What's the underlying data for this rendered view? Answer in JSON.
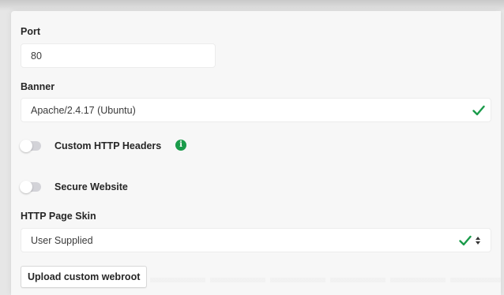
{
  "port": {
    "label": "Port",
    "value": "80"
  },
  "banner": {
    "label": "Banner",
    "value": "Apache/2.4.17 (Ubuntu)",
    "valid_icon": "check-icon"
  },
  "custom_headers": {
    "label": "Custom HTTP Headers",
    "enabled": false,
    "info_icon": "info-icon",
    "info_glyph": "i"
  },
  "secure_website": {
    "label": "Secure Website",
    "enabled": false
  },
  "page_skin": {
    "label": "HTTP Page Skin",
    "value": "User Supplied",
    "valid_icon": "check-icon",
    "select_icon": "select-arrows-icon"
  },
  "upload_button": {
    "label": "Upload custom webroot"
  },
  "colors": {
    "accent_green": "#1a9b4a",
    "toggle_off": "#d3d3d8",
    "panel_bg": "#f7f7f7"
  }
}
